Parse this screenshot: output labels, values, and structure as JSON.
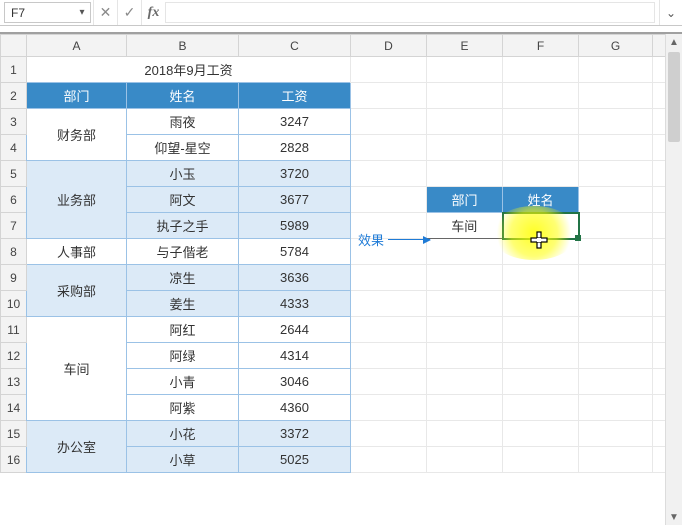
{
  "name_box": "F7",
  "formula_bar_value": "",
  "title": "2018年9月工资",
  "columns": [
    "A",
    "B",
    "C",
    "D",
    "E",
    "F",
    "G"
  ],
  "row_numbers": [
    1,
    2,
    3,
    4,
    5,
    6,
    7,
    8,
    9,
    10,
    11,
    12,
    13,
    14,
    15,
    16
  ],
  "headers": {
    "dept": "部门",
    "name": "姓名",
    "salary": "工资"
  },
  "rows": [
    {
      "dept": "财务部",
      "name": "雨夜",
      "salary": 3247,
      "zone": 1
    },
    {
      "dept": "",
      "name": "仰望-星空",
      "salary": 2828,
      "zone": 1
    },
    {
      "dept": "业务部",
      "name": "小玉",
      "salary": 3720,
      "zone": 2
    },
    {
      "dept": "",
      "name": "阿文",
      "salary": 3677,
      "zone": 2
    },
    {
      "dept": "",
      "name": "执子之手",
      "salary": 5989,
      "zone": 2
    },
    {
      "dept": "人事部",
      "name": "与子偕老",
      "salary": 5784,
      "zone": 1
    },
    {
      "dept": "采购部",
      "name": "凉生",
      "salary": 3636,
      "zone": 2
    },
    {
      "dept": "",
      "name": "姜生",
      "salary": 4333,
      "zone": 2
    },
    {
      "dept": "车间",
      "name": "阿红",
      "salary": 2644,
      "zone": 1
    },
    {
      "dept": "",
      "name": "阿绿",
      "salary": 4314,
      "zone": 1
    },
    {
      "dept": "",
      "name": "小青",
      "salary": 3046,
      "zone": 1
    },
    {
      "dept": "",
      "name": "阿紫",
      "salary": 4360,
      "zone": 1
    },
    {
      "dept": "办公室",
      "name": "小花",
      "salary": 3372,
      "zone": 2
    },
    {
      "dept": "",
      "name": "小草",
      "salary": 5025,
      "zone": 2
    }
  ],
  "dept_merges": [
    {
      "label": "财务部",
      "span": 2
    },
    {
      "label": "业务部",
      "span": 3
    },
    {
      "label": "人事部",
      "span": 1
    },
    {
      "label": "采购部",
      "span": 2
    },
    {
      "label": "车间",
      "span": 4
    },
    {
      "label": "办公室",
      "span": 2
    }
  ],
  "lookup": {
    "dept_header": "部门",
    "name_header": "姓名",
    "dept_value": "车间",
    "name_value": ""
  },
  "effect_label": "效果",
  "icons": {
    "dropdown": "▾",
    "cancel": "✕",
    "confirm": "✓",
    "fx": "fx",
    "expand": "⌄",
    "scroll_up": "▲",
    "scroll_down": "▼"
  }
}
